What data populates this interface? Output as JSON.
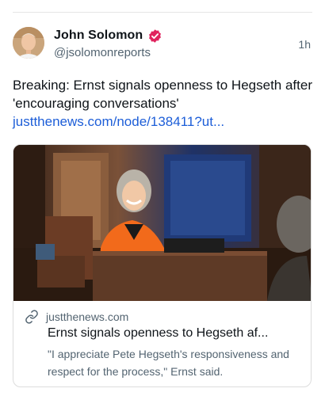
{
  "post": {
    "author_name": "John Solomon",
    "author_handle": "@jsolomonreports",
    "timestamp": "1h",
    "text": "Breaking: Ernst signals openness to Hegseth after 'encouraging conversations'",
    "link": "justthenews.com/node/138411?ut..."
  },
  "card": {
    "domain": "justthenews.com",
    "title": "Ernst signals openness to Hegseth af...",
    "description": "\"I appreciate Pete Hegseth's responsiveness and respect for the process,\" Ernst said."
  },
  "icons": {
    "verified": "verified-badge-icon",
    "link": "link-icon"
  },
  "colors": {
    "link": "#1d5ed8",
    "verified": "#e0245e",
    "secondary_text": "#536471"
  }
}
